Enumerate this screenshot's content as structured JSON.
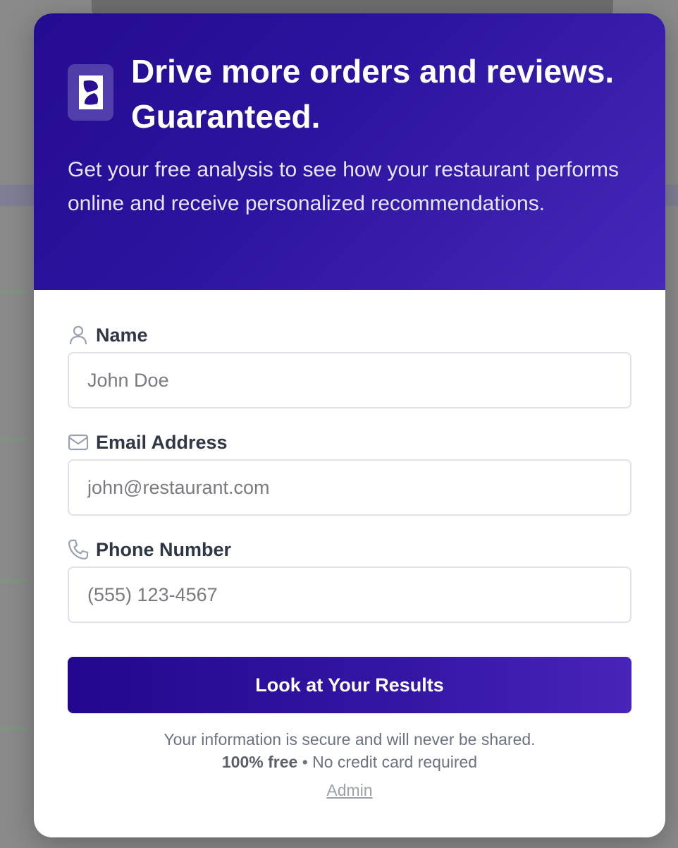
{
  "modal": {
    "headline": "Drive more orders and reviews. Guaranteed.",
    "subtext": "Get your free analysis to see how your restaurant performs online and receive personalized recommendations."
  },
  "form": {
    "name": {
      "label": "Name",
      "placeholder": "John Doe",
      "icon": "user-icon"
    },
    "email": {
      "label": "Email Address",
      "placeholder": "john@restaurant.com",
      "icon": "mail-icon"
    },
    "phone": {
      "label": "Phone Number",
      "placeholder": "(555) 123-4567",
      "icon": "phone-icon"
    },
    "submit_label": "Look at Your Results"
  },
  "footer": {
    "secure_note": "Your information is secure and will never be shared.",
    "free_strong": "100% free",
    "free_rest": " • No credit card required",
    "admin_link": "Admin"
  },
  "colors": {
    "header_gradient_start": "#240b8f",
    "header_gradient_end": "#4628b8",
    "label_text": "#2f3747",
    "muted_text": "#6b7280"
  }
}
